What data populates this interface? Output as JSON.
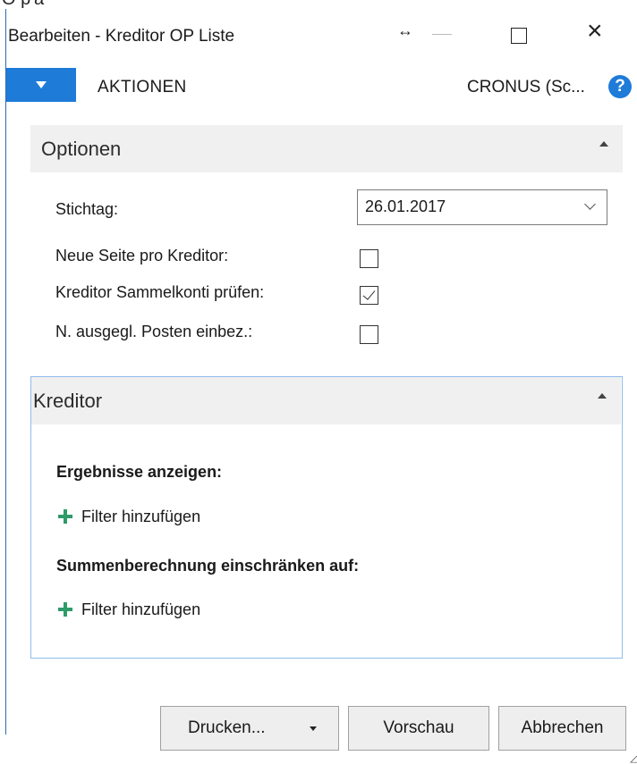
{
  "window": {
    "title": "Bearbeiten - Kreditor OP Liste",
    "top_strip_text": "Ö̈ p'a"
  },
  "actionbar": {
    "actions_label": "AKTIONEN",
    "company_label": "CRONUS (Sc...",
    "help_glyph": "?"
  },
  "optionen": {
    "title": "Optionen",
    "fields": {
      "stichtag_label": "Stichtag:",
      "stichtag_value": "26.01.2017",
      "neue_seite_label": "Neue Seite pro Kreditor:",
      "neue_seite_checked": false,
      "sammelkonti_label": "Kreditor Sammelkonti prüfen:",
      "sammelkonti_checked": true,
      "ausgegl_label": "N. ausgegl. Posten einbez.:",
      "ausgegl_checked": false
    }
  },
  "kreditor": {
    "title": "Kreditor",
    "results_heading": "Ergebnisse anzeigen:",
    "add_filter_1": "Filter hinzufügen",
    "sum_heading": "Summenberechnung einschränken auf:",
    "add_filter_2": "Filter hinzufügen"
  },
  "footer": {
    "print_label": "Drucken...",
    "preview_label": "Vorschau",
    "cancel_label": "Abbrechen"
  },
  "colors": {
    "accent": "#1e7bd8",
    "section_bg": "#f0f0f0",
    "plus_green": "#2e9b6a",
    "frame_border": "#8fbcec"
  }
}
